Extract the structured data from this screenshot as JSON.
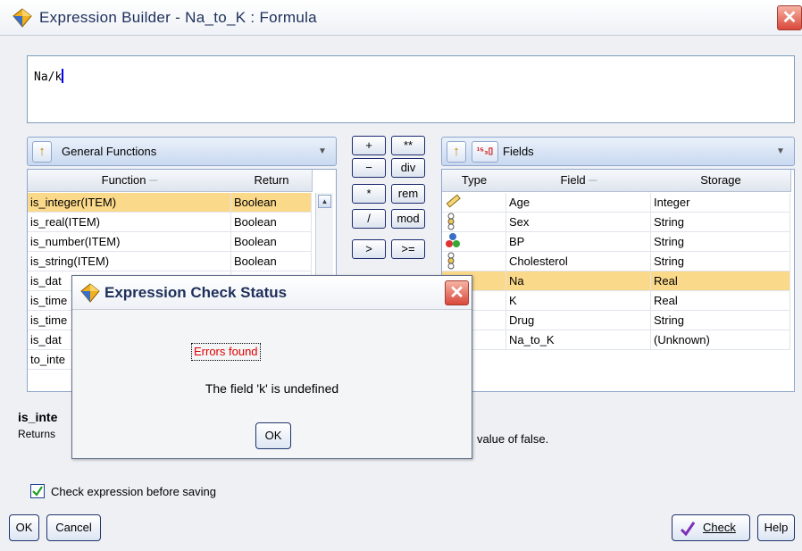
{
  "window": {
    "title": "Expression Builder - Na_to_K : Formula",
    "close_label": "✕"
  },
  "expression": {
    "text": "Na/k"
  },
  "functions_panel": {
    "category": "General Functions",
    "headers": {
      "function": "Function",
      "return": "Return"
    },
    "rows": [
      {
        "function": "is_integer(ITEM)",
        "return": "Boolean",
        "selected": true
      },
      {
        "function": "is_real(ITEM)",
        "return": "Boolean"
      },
      {
        "function": "is_number(ITEM)",
        "return": "Boolean"
      },
      {
        "function": "is_string(ITEM)",
        "return": "Boolean"
      },
      {
        "function": "is_dat",
        "return": ""
      },
      {
        "function": "is_time",
        "return": ""
      },
      {
        "function": "is_time",
        "return": ""
      },
      {
        "function": "is_dat",
        "return": ""
      },
      {
        "function": "to_inte",
        "return": ""
      }
    ]
  },
  "operators": {
    "plus": "+",
    "power": "**",
    "minus": "−",
    "div": "div",
    "times": "*",
    "rem": "rem",
    "divide": "/",
    "mod": "mod",
    "gt": ">",
    "gte": ">="
  },
  "fields_panel": {
    "category": "Fields",
    "headers": {
      "type": "Type",
      "field": "Field",
      "storage": "Storage"
    },
    "rows": [
      {
        "field": "Age",
        "storage": "Integer",
        "icon": "ruler-icon"
      },
      {
        "field": "Sex",
        "storage": "String",
        "icon": "flag-set-icon"
      },
      {
        "field": "BP",
        "storage": "String",
        "icon": "nominal-set-icon"
      },
      {
        "field": "Cholesterol",
        "storage": "String",
        "icon": "flag-set-icon"
      },
      {
        "field": "Na",
        "storage": "Real",
        "selected": true
      },
      {
        "field": "K",
        "storage": "Real"
      },
      {
        "field": "Drug",
        "storage": "String"
      },
      {
        "field": "Na_to_K",
        "storage": "(Unknown)"
      }
    ]
  },
  "description": {
    "name": "is_inte",
    "text_start": "Returns",
    "text_end": "value of false."
  },
  "check_before_saving": {
    "label": "Check expression before saving",
    "checked": true
  },
  "buttons": {
    "ok": "OK",
    "cancel": "Cancel",
    "check": "Check",
    "help": "Help"
  },
  "dialog": {
    "title": "Expression Check Status",
    "error_heading": "Errors found",
    "message": "The field 'k' is undefined",
    "ok": "OK",
    "close_label": "✕"
  },
  "colors": {
    "selection": "#fbd98a",
    "error_text": "#e00000",
    "accent_border": "#8fa7cc"
  }
}
